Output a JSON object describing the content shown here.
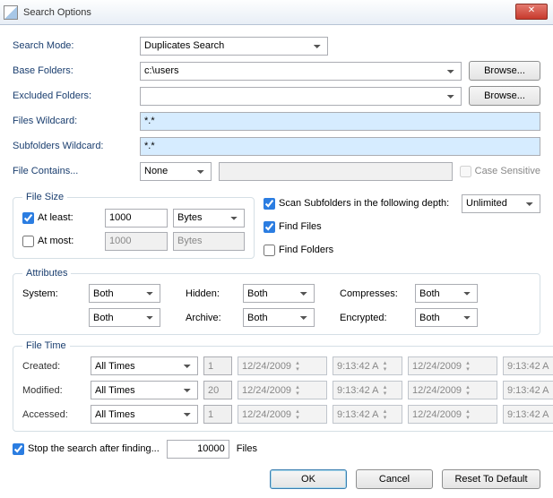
{
  "window": {
    "title": "Search Options",
    "close": "✕"
  },
  "labels": {
    "search_mode": "Search Mode:",
    "base_folders": "Base Folders:",
    "excluded_folders": "Excluded Folders:",
    "files_wildcard": "Files Wildcard:",
    "subfolders_wildcard": "Subfolders Wildcard:",
    "file_contains": "File Contains...",
    "case_sensitive": "Case Sensitive",
    "browse": "Browse...",
    "file_size": "File Size",
    "at_least": "At least:",
    "at_most": "At most:",
    "scan_depth": "Scan Subfolders in the following depth:",
    "find_files": "Find Files",
    "find_folders": "Find Folders",
    "attributes": "Attributes",
    "system": "System:",
    "hidden": "Hidden:",
    "compresses": "Compresses:",
    "archive": "Archive:",
    "encrypted": "Encrypted:",
    "file_time": "File Time",
    "created": "Created:",
    "modified": "Modified:",
    "accessed": "Accessed:",
    "stop_after": "Stop the search after finding...",
    "files": "Files",
    "ok": "OK",
    "cancel": "Cancel",
    "reset": "Reset To Default"
  },
  "values": {
    "search_mode": "Duplicates Search",
    "base_folders": "c:\\users",
    "excluded_folders": "",
    "files_wildcard": "*.*",
    "subfolders_wildcard": "*.*",
    "file_contains_mode": "None",
    "file_contains_text": "",
    "at_least_checked": true,
    "at_least_value": "1000",
    "at_least_unit": "Bytes",
    "at_most_checked": false,
    "at_most_value": "1000",
    "at_most_unit": "Bytes",
    "scan_depth_checked": true,
    "scan_depth_value": "Unlimited",
    "find_files_checked": true,
    "find_folders_checked": false,
    "attr_both": "Both",
    "time_mode": "All Times",
    "time_created_n": "1",
    "time_modified_n": "20",
    "time_accessed_n": "1",
    "date": "12/24/2009",
    "time": "9:13:42 A",
    "stop_after_checked": true,
    "stop_after_value": "10000"
  }
}
